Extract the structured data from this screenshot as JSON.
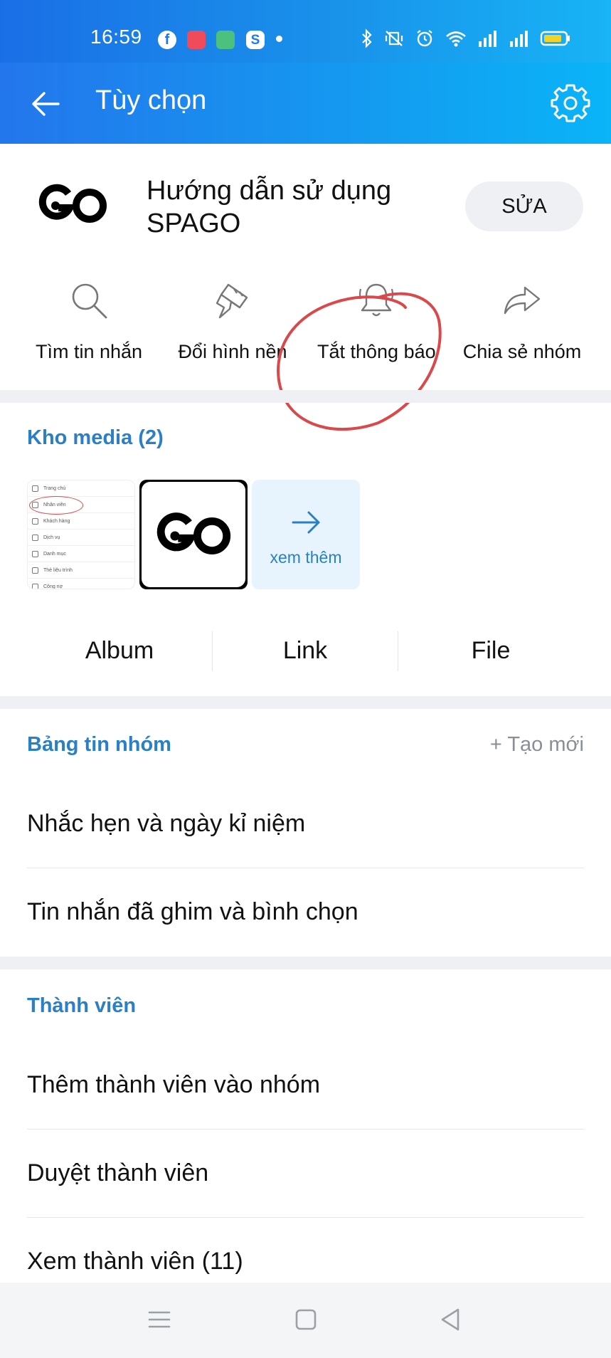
{
  "status_bar": {
    "time": "16:59",
    "app_icons": [
      "facebook-icon",
      "app-red-icon",
      "app-green-icon",
      "skype-icon"
    ]
  },
  "app_bar": {
    "title": "Tùy chọn"
  },
  "group": {
    "logo_text": "GO",
    "name": "Hướng dẫn sử dụng SPAGO",
    "edit_label": "SỬA"
  },
  "actions": [
    {
      "label": "Tìm tin nhắn",
      "icon": "search-icon"
    },
    {
      "label": "Đổi hình nền",
      "icon": "paint-brush-icon"
    },
    {
      "label": "Tắt thông báo",
      "icon": "bell-icon"
    },
    {
      "label": "Chia sẻ nhóm",
      "icon": "share-icon"
    }
  ],
  "media": {
    "title": "Kho media (2)",
    "thumb1_rows": [
      "Trang chủ",
      "Nhân viên",
      "Khách hàng",
      "Dịch vụ",
      "Danh mục",
      "Thẻ liệu trình",
      "Công nợ"
    ],
    "more_label": "xem thêm",
    "tabs": [
      "Album",
      "Link",
      "File"
    ]
  },
  "board": {
    "title": "Bảng tin nhóm",
    "new_label": "+ Tạo mới",
    "items": [
      "Nhắc hẹn và ngày kỉ niệm",
      "Tin nhắn đã ghim và bình chọn"
    ]
  },
  "members": {
    "title": "Thành viên",
    "items": [
      "Thêm thành viên vào nhóm",
      "Duyệt thành viên",
      "Xem thành viên (11)"
    ]
  },
  "colors": {
    "accent": "#2b7fc4",
    "header_start": "#2376ec",
    "header_end": "#0ab4f7",
    "annotation": "#d9484a"
  }
}
